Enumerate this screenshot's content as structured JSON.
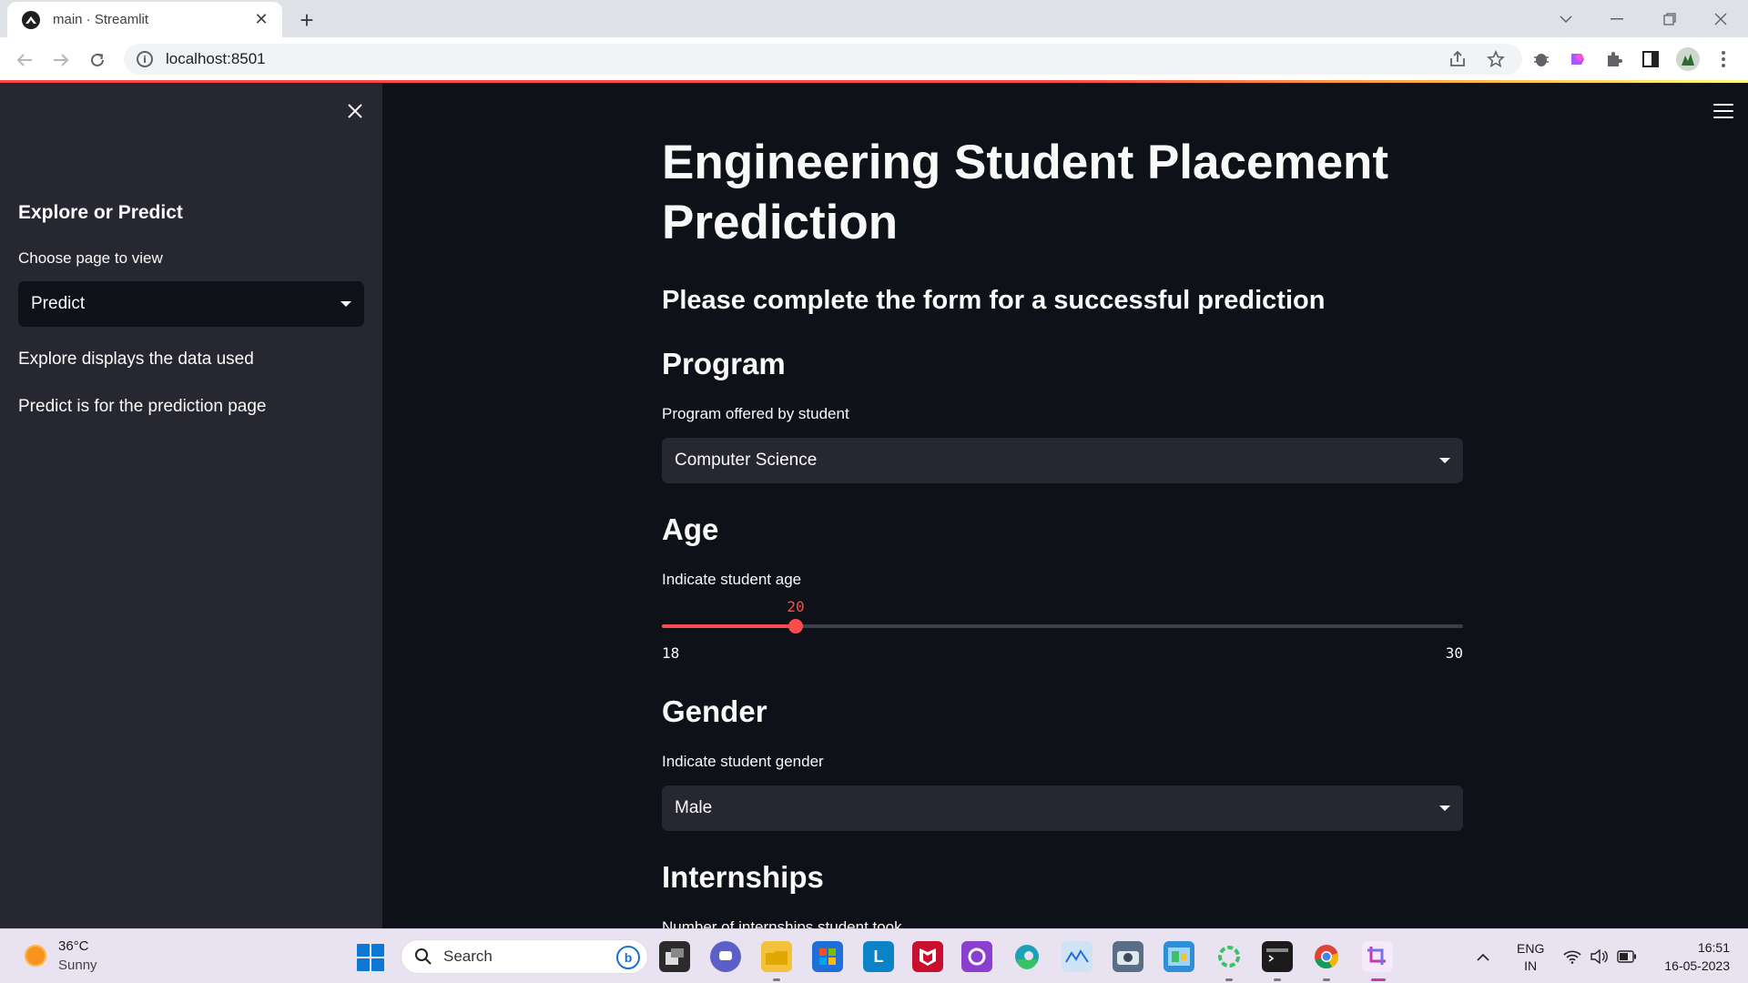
{
  "browser": {
    "tab_title": "main · Streamlit",
    "url": "localhost:8501"
  },
  "sidebar": {
    "title": "Explore or Predict",
    "select_label": "Choose page to view",
    "select_value": "Predict",
    "text_explore": "Explore displays the data used",
    "text_predict": "Predict is for the prediction page"
  },
  "main": {
    "title": "Engineering Student Placement Prediction",
    "subtitle": "Please complete the form for a successful prediction",
    "program": {
      "heading": "Program",
      "label": "Program offered by student",
      "value": "Computer Science"
    },
    "age": {
      "heading": "Age",
      "label": "Indicate student age",
      "value": 20,
      "value_text": "20",
      "min": 18,
      "min_text": "18",
      "max": 30,
      "max_text": "30"
    },
    "gender": {
      "heading": "Gender",
      "label": "Indicate student gender",
      "value": "Male"
    },
    "internships": {
      "heading": "Internships",
      "label": "Number of internships student took"
    }
  },
  "taskbar": {
    "weather_temp": "36°C",
    "weather_desc": "Sunny",
    "search_placeholder": "Search",
    "lang_line1": "ENG",
    "lang_line2": "IN",
    "time": "16:51",
    "date": "16-05-2023"
  },
  "colors": {
    "accent": "#ff4b4b",
    "sidebar_bg": "#262730",
    "main_bg": "#0e1117",
    "input_bg": "#262730"
  },
  "icons": [
    "streamlit-favicon",
    "close-icon",
    "plus-icon",
    "back-icon",
    "forward-icon",
    "reload-icon",
    "info-icon",
    "share-icon",
    "star-icon",
    "extension-icon",
    "sidebar-toggle-icon",
    "profile-avatar",
    "kebab-menu-icon",
    "hamburger-menu-icon",
    "caret-down-icon",
    "windows-start-icon",
    "search-icon",
    "bing-icon",
    "wifi-icon",
    "volume-icon",
    "battery-icon"
  ]
}
